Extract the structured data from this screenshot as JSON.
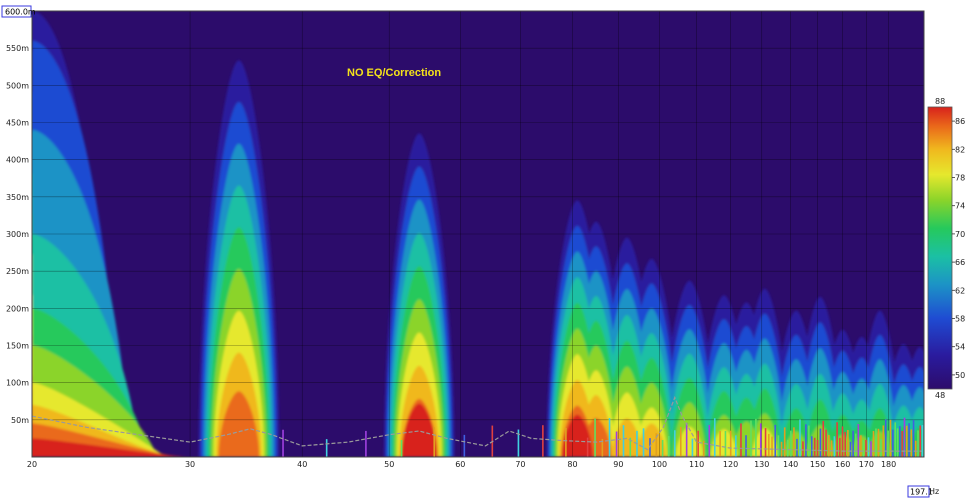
{
  "chart_data": {
    "type": "heatmap",
    "title": "NO EQ/Correction",
    "title_color": "#f4e21a",
    "background_color": "#2c0c6b",
    "x_scale": "log",
    "xlim": [
      20,
      197.1
    ],
    "ylim": [
      0,
      600
    ],
    "x_unit_label": "Hz",
    "y_tick_labels": [
      "50m",
      "100m",
      "150m",
      "200m",
      "250m",
      "300m",
      "350m",
      "400m",
      "450m",
      "500m",
      "550m"
    ],
    "y_tick_values": [
      50,
      100,
      150,
      200,
      250,
      300,
      350,
      400,
      450,
      500,
      550
    ],
    "y_max_marker": "600.0m",
    "x_tick_labels": [
      "20",
      "30",
      "40",
      "50",
      "60",
      "70",
      "80",
      "90",
      "100",
      "110",
      "120",
      "130",
      "140",
      "150",
      "160",
      "170",
      "180"
    ],
    "x_tick_values": [
      20,
      30,
      40,
      50,
      60,
      70,
      80,
      90,
      100,
      110,
      120,
      130,
      140,
      150,
      160,
      170,
      180
    ],
    "x_max_marker": "197.1",
    "colorbar": {
      "min_label": "48",
      "max_label": "88",
      "tick_labels": [
        "50",
        "54",
        "58",
        "62",
        "66",
        "70",
        "74",
        "78",
        "82",
        "86"
      ],
      "tick_values": [
        50,
        54,
        58,
        62,
        66,
        70,
        74,
        78,
        82,
        86
      ],
      "colors": [
        "#2c0c6b",
        "#2a1b9e",
        "#1f4bd2",
        "#1c93c6",
        "#1bc0a4",
        "#26c95c",
        "#8bd42a",
        "#e6e82d",
        "#f0b81e",
        "#ea6a1a",
        "#d8221c"
      ]
    },
    "ridges_note_values": [
      {
        "freq": 20,
        "decay_ms": 600,
        "level": 88
      },
      {
        "freq": 34,
        "decay_ms": 590,
        "level": 86
      },
      {
        "freq": 54,
        "decay_ms": 480,
        "level": 87
      },
      {
        "freq": 81,
        "decay_ms": 380,
        "level": 88
      },
      {
        "freq": 85,
        "decay_ms": 350,
        "level": 86
      },
      {
        "freq": 92,
        "decay_ms": 330,
        "level": 82
      },
      {
        "freq": 98,
        "decay_ms": 300,
        "level": 80
      },
      {
        "freq": 108,
        "decay_ms": 270,
        "level": 77
      },
      {
        "freq": 118,
        "decay_ms": 250,
        "level": 75
      },
      {
        "freq": 125,
        "decay_ms": 240,
        "level": 74
      },
      {
        "freq": 131,
        "decay_ms": 260,
        "level": 75
      },
      {
        "freq": 142,
        "decay_ms": 230,
        "level": 72
      },
      {
        "freq": 151,
        "decay_ms": 250,
        "level": 73
      },
      {
        "freq": 160,
        "decay_ms": 200,
        "level": 72
      },
      {
        "freq": 168,
        "decay_ms": 190,
        "level": 71
      },
      {
        "freq": 176,
        "decay_ms": 230,
        "level": 72
      },
      {
        "freq": 187,
        "decay_ms": 180,
        "level": 70
      },
      {
        "freq": 195,
        "decay_ms": 175,
        "level": 70
      }
    ]
  }
}
